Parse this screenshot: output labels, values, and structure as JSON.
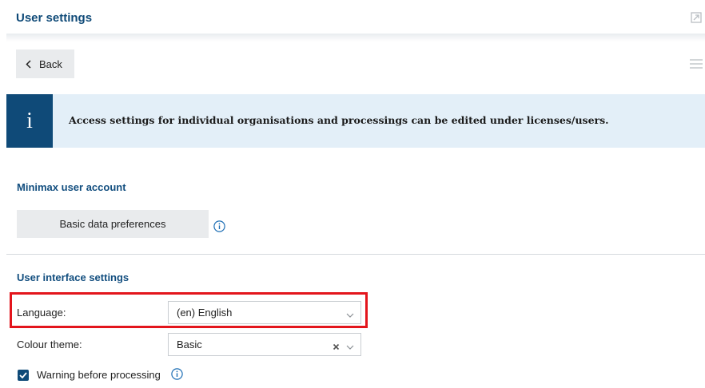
{
  "header": {
    "title": "User settings",
    "expand_icon": "expand-window-icon"
  },
  "toolbar": {
    "back_label": "Back",
    "menu_icon": "hamburger-menu-icon"
  },
  "info_banner": {
    "icon_glyph": "i",
    "text": "Access settings for individual organisations and processings can be edited under licenses/users."
  },
  "minimax_account": {
    "heading": "Minimax user account",
    "basic_data_button": "Basic data preferences"
  },
  "ui_settings": {
    "heading": "User interface settings",
    "language_label": "Language:",
    "language_value": "(en) English",
    "colour_theme_label": "Colour theme:",
    "colour_theme_value": "Basic",
    "warning_label": "Warning before processing",
    "warning_checked": true
  },
  "colors": {
    "brand": "#0f4a78",
    "highlight": "#e3151c",
    "info_bg": "#e3eff8",
    "button_bg": "#e9ebed"
  }
}
